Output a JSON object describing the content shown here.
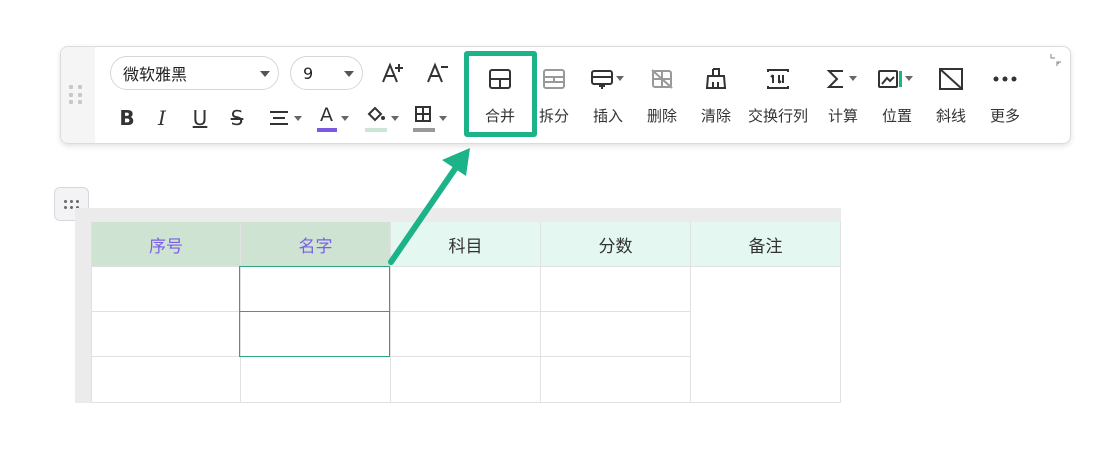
{
  "toolbar": {
    "font_family": "微软雅黑",
    "font_size": "9",
    "buttons": [
      {
        "id": "merge",
        "label": "合并"
      },
      {
        "id": "split",
        "label": "拆分"
      },
      {
        "id": "insert",
        "label": "插入"
      },
      {
        "id": "delete",
        "label": "删除"
      },
      {
        "id": "clear",
        "label": "清除"
      },
      {
        "id": "swap",
        "label": "交换行列"
      },
      {
        "id": "calc",
        "label": "计算"
      },
      {
        "id": "position",
        "label": "位置"
      },
      {
        "id": "diagonal",
        "label": "斜线"
      },
      {
        "id": "more",
        "label": "更多"
      }
    ],
    "format": {
      "bold": "B",
      "italic": "I",
      "underline": "U",
      "strike": "S",
      "font_color": "A"
    }
  },
  "table": {
    "headers": [
      "序号",
      "名字",
      "科目",
      "分数",
      "备注"
    ],
    "rows": [
      [
        "",
        "",
        "",
        ""
      ],
      [
        "",
        "",
        "",
        ""
      ],
      [
        "",
        "",
        "",
        ""
      ]
    ]
  },
  "colors": {
    "accent": "#1cb388",
    "header_bg": "#e4f7f0",
    "selected_header_bg": "#cfe3d3",
    "selected_header_text": "#7a60e6",
    "font_color_bar": "#7a5ae0"
  }
}
